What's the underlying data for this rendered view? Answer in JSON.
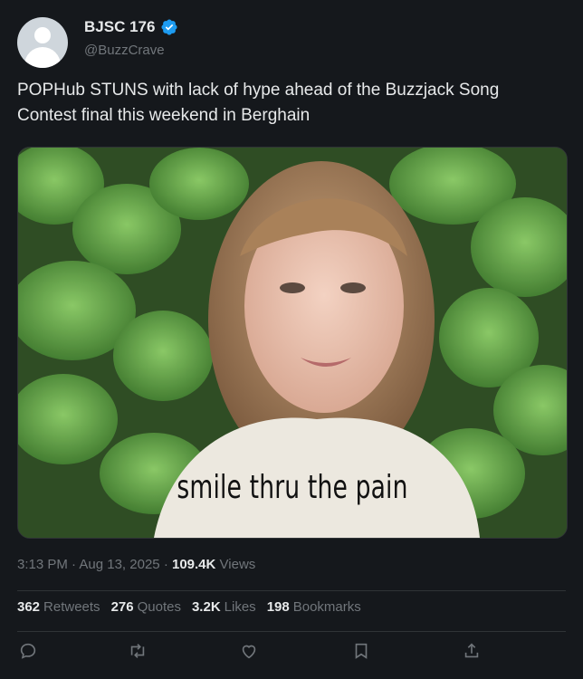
{
  "author": {
    "name": "BJSC 176",
    "handle": "@BuzzCrave",
    "verified": true
  },
  "tweet": {
    "text": "POPHub STUNS with lack of hype ahead of the Buzzjack Song Contest final this weekend in Berghain",
    "media_caption": "smile thru the pain"
  },
  "meta": {
    "time": "3:13 PM",
    "date": "Aug 13, 2025",
    "views_count": "109.4K",
    "views_label": "Views"
  },
  "stats": {
    "retweets_count": "362",
    "retweets_label": "Retweets",
    "quotes_count": "276",
    "quotes_label": "Quotes",
    "likes_count": "3.2K",
    "likes_label": "Likes",
    "bookmarks_count": "198",
    "bookmarks_label": "Bookmarks"
  },
  "actions": [
    "reply-icon",
    "retweet-icon",
    "like-icon",
    "bookmark-icon",
    "share-icon"
  ],
  "colors": {
    "background": "#15181c",
    "verified": "#1d9bf0",
    "muted": "#71767b",
    "text": "#e7e9ea"
  }
}
